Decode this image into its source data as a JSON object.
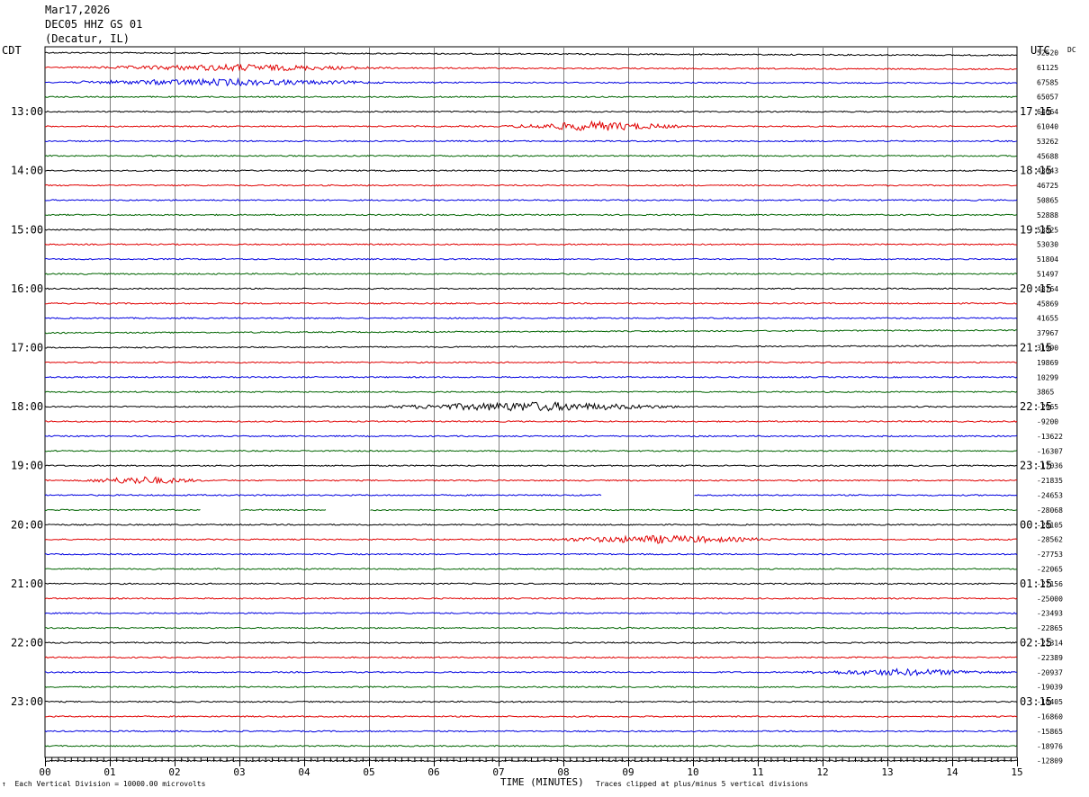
{
  "header": {
    "date": "Mar17,2026",
    "station": "DEC05 HHZ GS 01",
    "location": "(Decatur, IL)"
  },
  "left_tz": "CDT",
  "right_tz": "UTC",
  "dc_label": "DC",
  "footer": {
    "scale": "Each Vertical Division = 10000.00 microvolts",
    "clip": "Traces clipped at plus/minus 5 vertical divisions"
  },
  "colors": {
    "trace_cycle": [
      "#000000",
      "#e00000",
      "#0000e0",
      "#006400"
    ],
    "grid": "#808080"
  },
  "chart_data": {
    "type": "line",
    "xlabel": "TIME (MINUTES)",
    "xlim": [
      0,
      15
    ],
    "x_ticks": [
      "00",
      "01",
      "02",
      "03",
      "04",
      "05",
      "06",
      "07",
      "08",
      "09",
      "10",
      "11",
      "12",
      "13",
      "14",
      "15"
    ],
    "left_hour_labels": [
      "13:00",
      "14:00",
      "15:00",
      "16:00",
      "17:00",
      "18:00",
      "19:00",
      "20:00",
      "21:00",
      "22:00",
      "23:00"
    ],
    "right_hour_labels": [
      "17:15",
      "18:15",
      "19:15",
      "20:15",
      "21:15",
      "22:15",
      "23:15",
      "00:15",
      "01:15",
      "02:15",
      "03:15"
    ],
    "dc_offsets": [
      "52520",
      "61125",
      "67585",
      "65057",
      "64664",
      "61040",
      "53262",
      "45688",
      "43043",
      "46725",
      "50865",
      "52888",
      "53825",
      "53030",
      "51804",
      "51497",
      "48764",
      "45869",
      "41655",
      "37967",
      "31990",
      "19869",
      "10299",
      "3865",
      "-2965",
      "-9200",
      "-13622",
      "-16307",
      "-17036",
      "-21835",
      "-24653",
      "-28068",
      "-28105",
      "-28562",
      "-27753",
      "-22065",
      "-27156",
      "-25000",
      "-23493",
      "-22865",
      "-22314",
      "-22389",
      "-20937",
      "-19039",
      "-18405",
      "-16860",
      "-15865",
      "-18976",
      "-12809"
    ],
    "events": [
      {
        "trace": 1,
        "from_min": 0.5,
        "to_min": 5.5,
        "amp": 4
      },
      {
        "trace": 2,
        "from_min": 0.0,
        "to_min": 5.5,
        "amp": 4
      },
      {
        "trace": 5,
        "from_min": 7.0,
        "to_min": 10.0,
        "amp": 6
      },
      {
        "trace": 24,
        "from_min": 5.0,
        "to_min": 10.0,
        "amp": 6
      },
      {
        "trace": 29,
        "from_min": 0.5,
        "to_min": 2.5,
        "amp": 5
      },
      {
        "trace": 33,
        "from_min": 7.5,
        "to_min": 11.5,
        "amp": 5
      },
      {
        "trace": 42,
        "from_min": 11.5,
        "to_min": 15.0,
        "amp": 4
      }
    ],
    "gaps": [
      {
        "trace": 30,
        "from_min": 8.6,
        "to_min": 10.0
      },
      {
        "trace": 31,
        "from_min": 2.4,
        "to_min": 3.0
      },
      {
        "trace": 31,
        "from_min": 4.35,
        "to_min": 5.0
      }
    ]
  }
}
